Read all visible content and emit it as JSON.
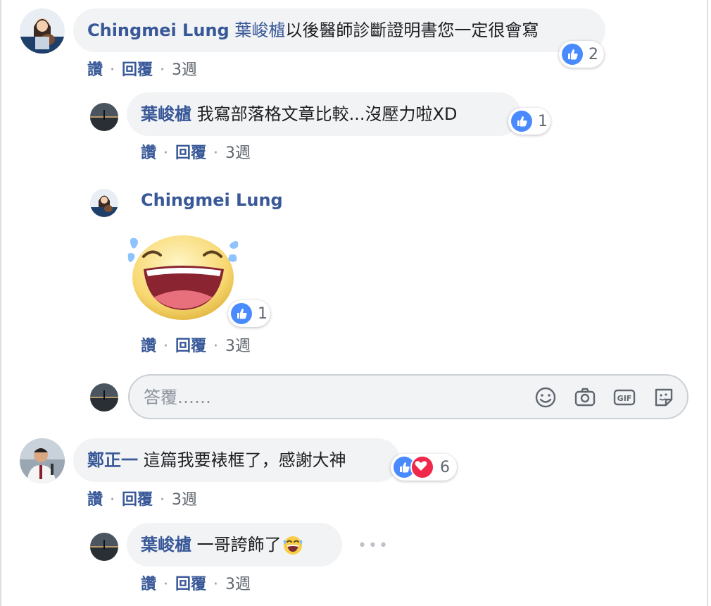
{
  "comments": [
    {
      "author": "Chingmei Lung",
      "mention": "葉峻樝",
      "text": "以後醫師診斷證明書您一定很會寫",
      "reactions": {
        "count": "2",
        "icon": "like-icon"
      },
      "actions": {
        "like": "讚",
        "reply": "回覆",
        "time": "3週"
      },
      "replies": [
        {
          "author": "葉峻樝",
          "text": "我寫部落格文章比較...沒壓力啦XD",
          "reactions": {
            "count": "1",
            "icon": "like-icon"
          },
          "actions": {
            "like": "讚",
            "reply": "回覆",
            "time": "3週"
          }
        },
        {
          "author": "Chingmei Lung",
          "sticker": "laughing-tears-sticker",
          "reactions": {
            "count": "1",
            "icon": "like-icon"
          },
          "actions": {
            "like": "讚",
            "reply": "回覆",
            "time": "3週"
          }
        }
      ]
    },
    {
      "author": "鄭正一",
      "text": "這篇我要裱框了，感謝大神",
      "reactions": {
        "count": "6",
        "icons": [
          "like-icon",
          "love-icon"
        ]
      },
      "actions": {
        "like": "讚",
        "reply": "回覆",
        "time": "3週"
      },
      "replies": [
        {
          "author": "葉峻樝",
          "text": "一哥誇飾了",
          "emoji": "laughing-tears-emoji",
          "actions": {
            "like": "讚",
            "reply": "回覆",
            "time": "3週"
          }
        }
      ]
    }
  ],
  "reply_box": {
    "placeholder": "答覆……",
    "tools": [
      "smiley-icon",
      "camera-icon",
      "gif-icon",
      "sticker-icon"
    ]
  },
  "colors": {
    "link": "#385898",
    "bubble": "#f2f3f5",
    "like": "#4a8aff",
    "love": "#f0284a",
    "meta": "#90949c"
  }
}
